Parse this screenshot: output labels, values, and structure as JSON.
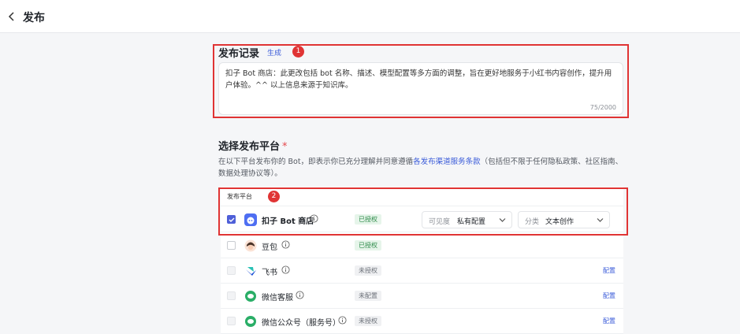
{
  "header": {
    "title": "发布"
  },
  "release_record": {
    "title": "发布记录",
    "generate_label": "生成",
    "text": "扣子 Bot 商店：此更改包括 bot 名称、描述、模型配置等多方面的调整，旨在更好地服务于小红书内容创作，提升用户体验。^^ 以上信息来源于知识库。",
    "char_count": "75/2000"
  },
  "platforms_section": {
    "title": "选择发布平台",
    "required_mark": "*",
    "desc_prefix": "在以下平台发布你的 Bot，即表示你已充分理解并同意遵循",
    "desc_link": "各发布渠道服务条款",
    "desc_suffix": "（包括但不限于任何隐私政策、社区指南、数据处理协议等）。",
    "table_header": "发布平台"
  },
  "platforms": [
    {
      "name": "扣子 Bot 商店",
      "status": "已授权"
    },
    {
      "name": "豆包",
      "status": "已授权"
    },
    {
      "name": "飞书",
      "status": "未授权",
      "action": "配置"
    },
    {
      "name": "微信客服",
      "status": "未配置",
      "action": "配置"
    },
    {
      "name": "微信公众号（服务号）",
      "status": "未授权",
      "action": "配置"
    }
  ],
  "bot_store_options": {
    "visibility_label": "可见度",
    "visibility_value": "私有配置",
    "category_label": "分类",
    "category_value": "文本创作"
  },
  "annotations": [
    "1",
    "2"
  ],
  "colors": {
    "accent": "#4e5fd8",
    "link": "#3a5bd9",
    "annotation": "#e03434",
    "authorized": "#2e8b4a"
  }
}
